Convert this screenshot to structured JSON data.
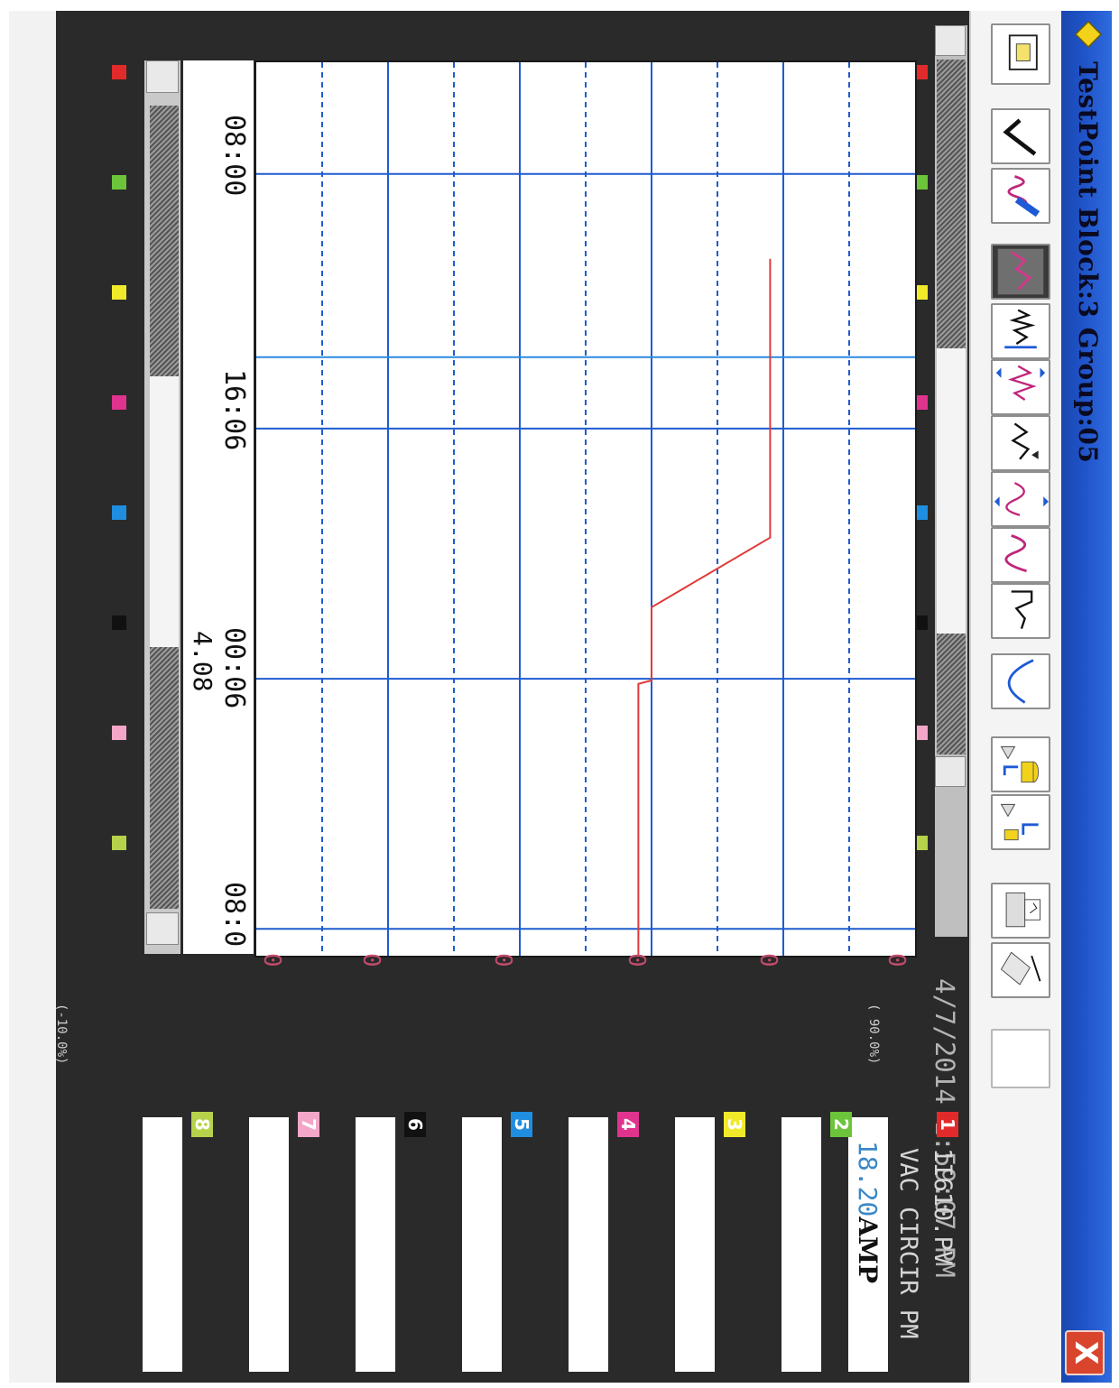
{
  "window": {
    "title": "TestPoint Block:3 Group:05",
    "close_label": "X",
    "datetime": "4/7/2014  1:59:07 PM"
  },
  "toolbar": {
    "buttons": [
      {
        "name": "view-icon"
      },
      {
        "name": "check-icon"
      },
      {
        "name": "pen-trend-icon"
      },
      {
        "name": "trend-filled-icon",
        "pressed": true
      },
      {
        "name": "trend-cursor-icon"
      },
      {
        "name": "trend-vertical-zoom-icon"
      },
      {
        "name": "trend-arrows-icon"
      },
      {
        "name": "trend-expand-icon"
      },
      {
        "name": "trend-wave-icon"
      },
      {
        "name": "trend-sweep-icon"
      },
      {
        "name": "curve-icon"
      },
      {
        "name": "save-db-icon"
      },
      {
        "name": "load-db-icon"
      },
      {
        "name": "print-icon"
      },
      {
        "name": "export-icon"
      },
      {
        "name": "blank-icon"
      }
    ]
  },
  "time_axis": {
    "labels": [
      "08:00",
      "16:06",
      "00:06",
      "08:0"
    ],
    "cursor_value": "4.08"
  },
  "scale": {
    "zero_labels": [
      "0",
      "0",
      "0",
      "0",
      "0",
      "0"
    ],
    "top_note": "( 90.0%)",
    "bottom_note": "(-10.0%)"
  },
  "channels": [
    {
      "number": "1",
      "color": "#e22a2a",
      "tag": "1I610.PV",
      "desc": "VAC CIRCIR PM",
      "value": "18.20",
      "unit": "AMP"
    },
    {
      "number": "2",
      "color": "#6cc43a",
      "value": ""
    },
    {
      "number": "3",
      "color": "#f0ea2a",
      "value": ""
    },
    {
      "number": "4",
      "color": "#e0338e",
      "value": ""
    },
    {
      "number": "5",
      "color": "#1f8ee0",
      "value": ""
    },
    {
      "number": "6",
      "color": "#111111",
      "value": ""
    },
    {
      "number": "7",
      "color": "#f3a6c8",
      "value": ""
    },
    {
      "number": "8",
      "color": "#b6d24a",
      "value": ""
    }
  ],
  "chart_data": {
    "type": "line",
    "series": [
      {
        "x": [
          0,
          0.4,
          0.5,
          0.51,
          0.6,
          0.605,
          0.61,
          0.62,
          0.66,
          0.7,
          0.74,
          0.78,
          0.88,
          1.0
        ],
        "y": [
          78,
          78,
          60,
          60,
          60,
          60,
          58,
          58,
          58,
          58,
          58,
          58,
          58,
          58
        ]
      }
    ]
  }
}
